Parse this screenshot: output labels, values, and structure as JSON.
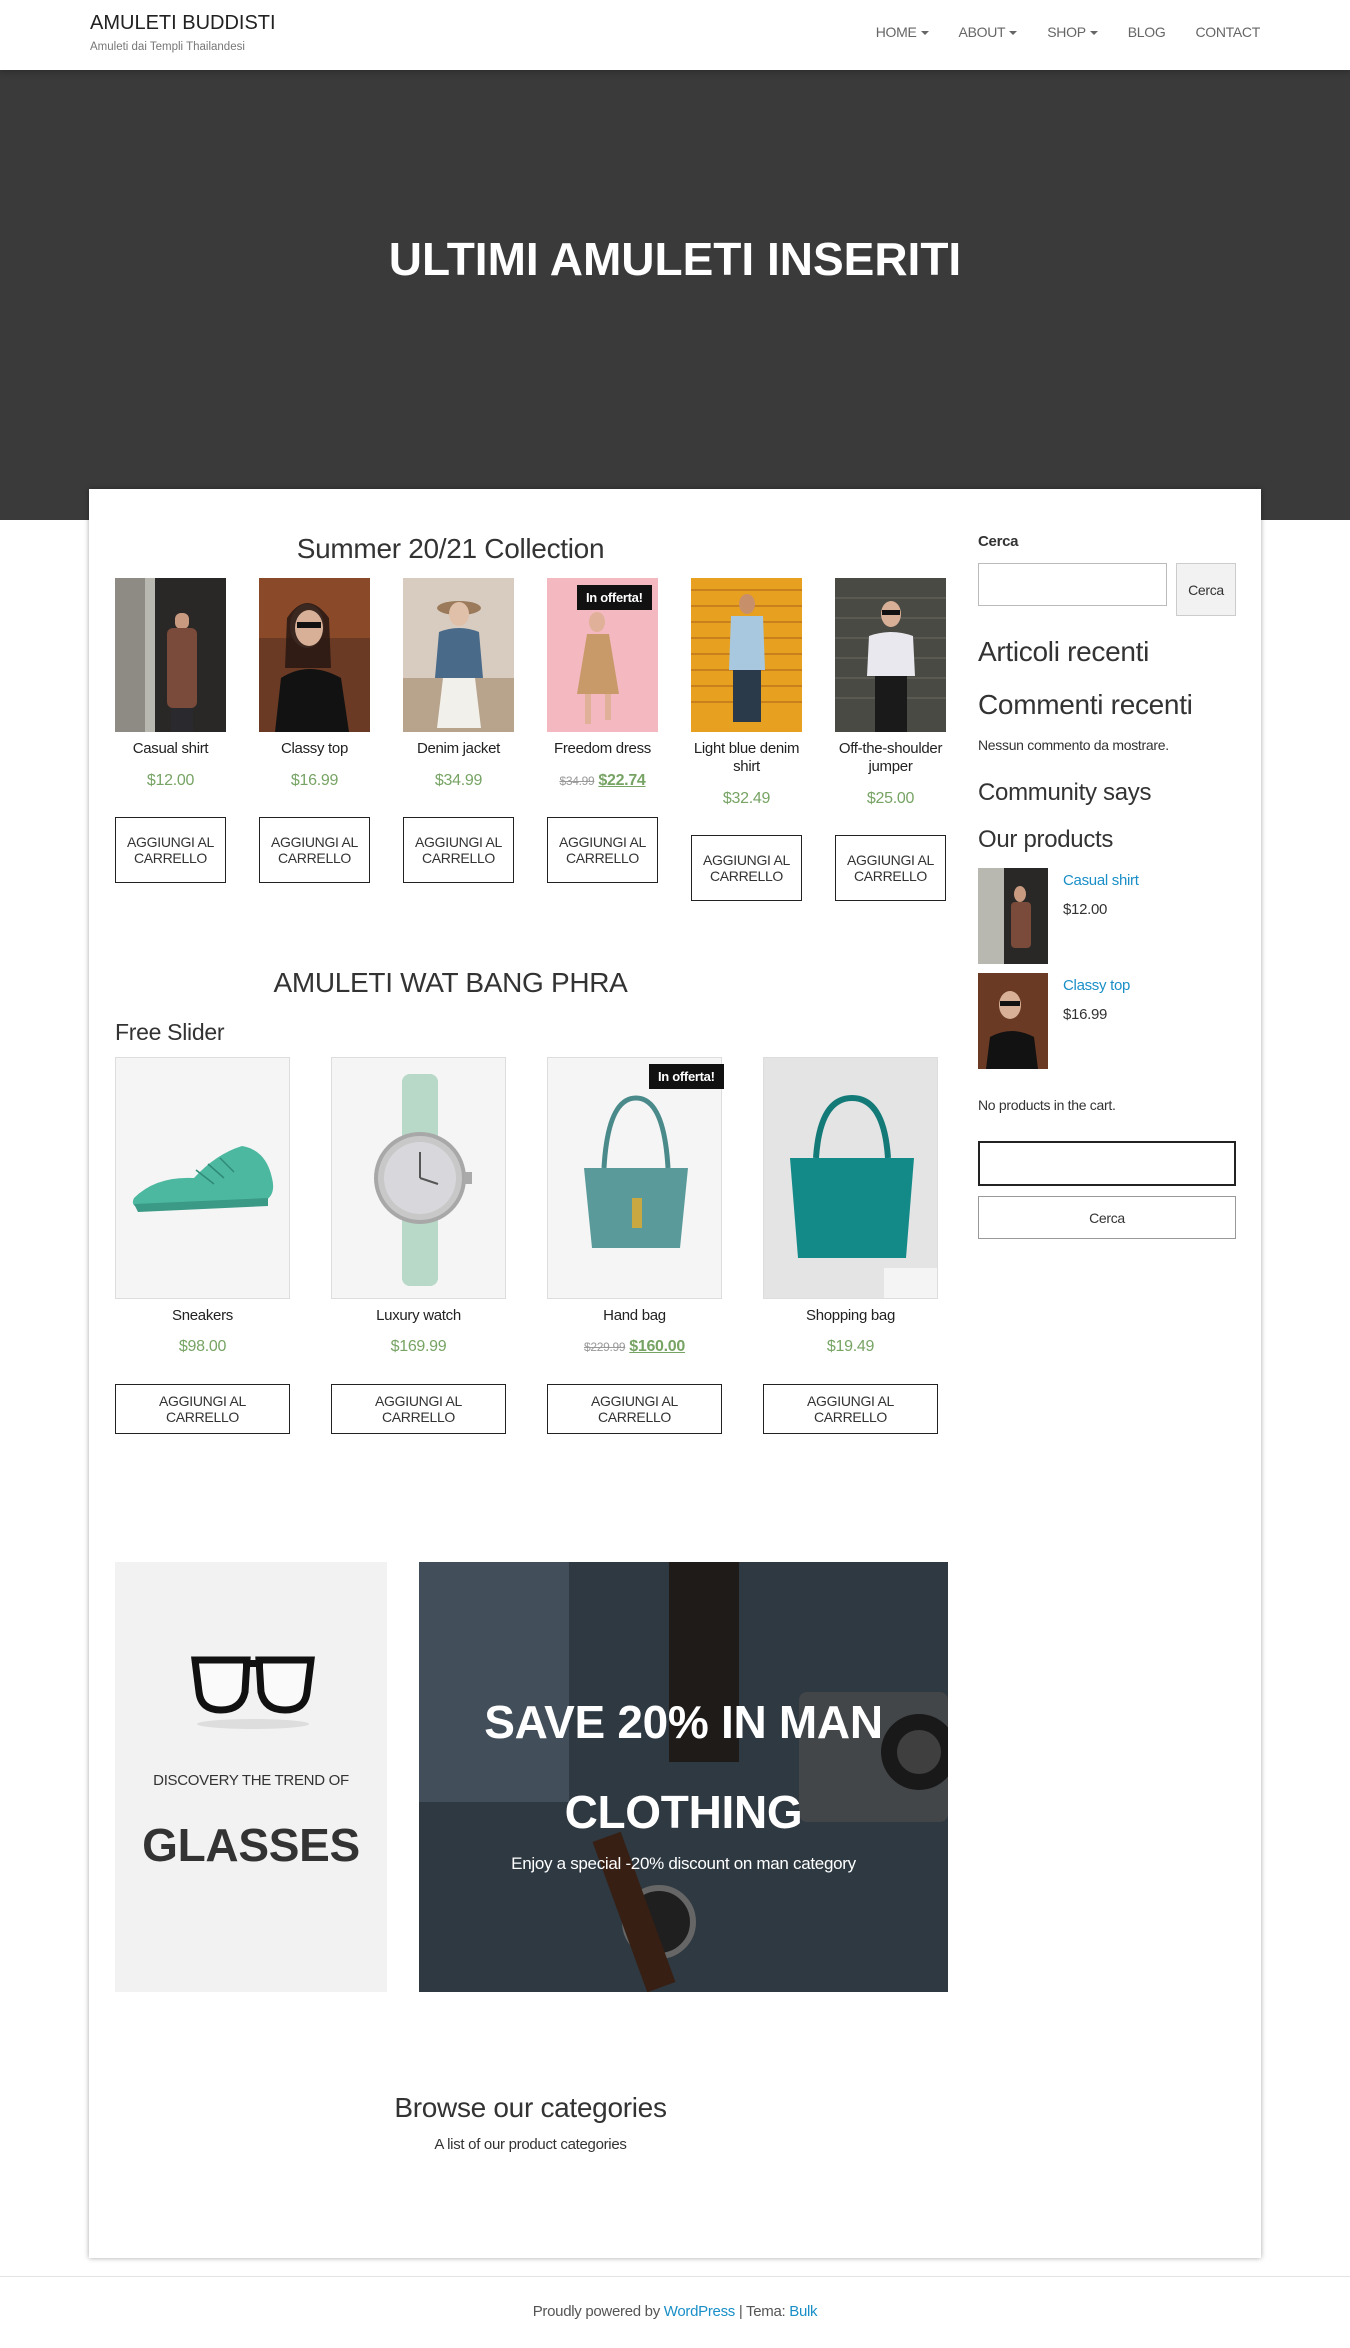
{
  "site": {
    "title": "AMULETI BUDDISTI",
    "tagline": "Amuleti dai Templi Thailandesi"
  },
  "menu": [
    {
      "label": "HOME",
      "dropdown": true
    },
    {
      "label": "ABOUT",
      "dropdown": true
    },
    {
      "label": "SHOP",
      "dropdown": true
    },
    {
      "label": "BLOG",
      "dropdown": false
    },
    {
      "label": "CONTACT",
      "dropdown": false
    }
  ],
  "hero": {
    "title": "ULTIMI AMULETI INSERITI"
  },
  "collection": {
    "title": "Summer 20/21 Collection",
    "products": [
      {
        "name": "Casual shirt",
        "price": "$12.00",
        "button": "AGGIUNGI AL CARRELLO"
      },
      {
        "name": "Classy top",
        "price": "$16.99",
        "button": "AGGIUNGI AL CARRELLO"
      },
      {
        "name": "Denim jacket",
        "price": "$34.99",
        "button": "AGGIUNGI AL CARRELLO"
      },
      {
        "name": "Freedom dress",
        "old_price": "$34.99",
        "price": "$22.74",
        "badge": "In offerta!",
        "button": "AGGIUNGI AL CARRELLO"
      },
      {
        "name": "Light blue denim shirt",
        "price": "$32.49",
        "button": "AGGIUNGI AL CARRELLO"
      },
      {
        "name": "Off-the-shoulder jumper",
        "price": "$25.00",
        "button": "AGGIUNGI AL CARRELLO"
      }
    ]
  },
  "amuleti": {
    "title": "AMULETI WAT BANG PHRA",
    "slider_label": "Free Slider",
    "products": [
      {
        "name": "Sneakers",
        "price": "$98.00",
        "button": "AGGIUNGI AL CARRELLO"
      },
      {
        "name": "Luxury watch",
        "price": "$169.99",
        "button": "AGGIUNGI AL CARRELLO"
      },
      {
        "name": "Hand bag",
        "old_price": "$229.99",
        "price": "$160.00",
        "badge": "In offerta!",
        "button": "AGGIUNGI AL CARRELLO"
      },
      {
        "name": "Shopping bag",
        "price": "$19.49",
        "button": "AGGIUNGI AL CARRELLO"
      }
    ]
  },
  "promo_glasses": {
    "subtitle": "DISCOVERY THE TREND OF",
    "title": "GLASSES"
  },
  "promo_man": {
    "title": "SAVE 20% IN MAN CLOTHING",
    "text": "Enjoy a special -20% discount on man category"
  },
  "categories": {
    "title": "Browse our categories",
    "subtitle": "A list of our product categories"
  },
  "sidebar": {
    "search_label": "Cerca",
    "search_button": "Cerca",
    "recent_posts": "Articoli recenti",
    "recent_comments": "Commenti recenti",
    "no_comments": "Nessun commento da mostrare.",
    "community": "Community says",
    "our_products": "Our products",
    "products": [
      {
        "name": "Casual shirt",
        "price": "$12.00"
      },
      {
        "name": "Classy top",
        "price": "$16.99"
      }
    ],
    "cart_empty": "No products in the cart.",
    "search2_button": "Cerca"
  },
  "footer": {
    "prefix": "Proudly powered by",
    "wordpress": "WordPress",
    "sep": " | Tema: ",
    "theme": "Bulk"
  },
  "colors": {
    "price": "#77a464",
    "link": "#1a8fc7",
    "hero_bg": "#3a3a3a"
  }
}
